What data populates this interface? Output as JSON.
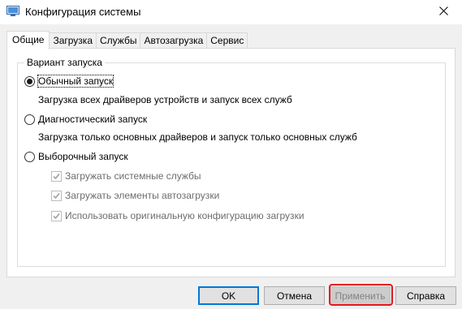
{
  "window": {
    "title": "Конфигурация системы",
    "icon": "system-config-icon",
    "close_icon": "close-icon"
  },
  "tabs": [
    {
      "label": "Общие",
      "active": true
    },
    {
      "label": "Загрузка",
      "active": false
    },
    {
      "label": "Службы",
      "active": false
    },
    {
      "label": "Автозагрузка",
      "active": false
    },
    {
      "label": "Сервис",
      "active": false
    }
  ],
  "startup_group": {
    "title": "Вариант запуска",
    "normal": {
      "label": "Обычный запуск",
      "description": "Загрузка всех драйверов устройств и запуск всех служб",
      "selected": true
    },
    "diagnostic": {
      "label": "Диагностический запуск",
      "description": "Загрузка только основных драйверов и запуск только основных служб",
      "selected": false
    },
    "selective": {
      "label": "Выборочный запуск",
      "selected": false,
      "options": [
        {
          "label": "Загружать системные службы",
          "checked": true,
          "disabled": true
        },
        {
          "label": "Загружать элементы автозагрузки",
          "checked": true,
          "disabled": true
        },
        {
          "label": "Использовать оригинальную конфигурацию загрузки",
          "checked": true,
          "disabled": true
        }
      ]
    }
  },
  "buttons": {
    "ok": "OK",
    "cancel": "Отмена",
    "apply": "Применить",
    "help": "Справка"
  },
  "colors": {
    "accent": "#0078d7",
    "annotation": "#e8141d"
  }
}
